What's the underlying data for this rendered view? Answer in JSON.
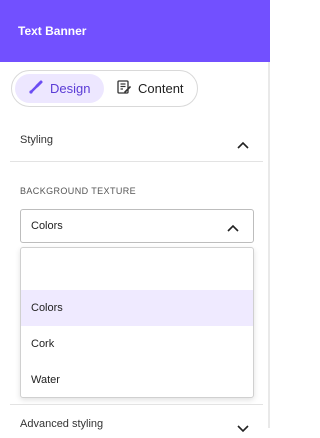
{
  "header": {
    "title": "Text Banner"
  },
  "tabs": [
    {
      "label": "Design",
      "icon": "brush-icon",
      "active": true
    },
    {
      "label": "Content",
      "icon": "document-edit-icon",
      "active": false
    }
  ],
  "sections": {
    "styling": {
      "label": "Styling",
      "expanded": true
    },
    "advanced": {
      "label": "Advanced styling",
      "expanded": false
    }
  },
  "background_texture": {
    "label": "BACKGROUND TEXTURE",
    "selected": "Colors",
    "options": [
      "",
      "Colors",
      "Cork",
      "Water"
    ]
  },
  "colors": {
    "accent": "#7250ff",
    "active_tab_bg": "#ede7ff",
    "selected_option_bg": "#efeaff"
  }
}
